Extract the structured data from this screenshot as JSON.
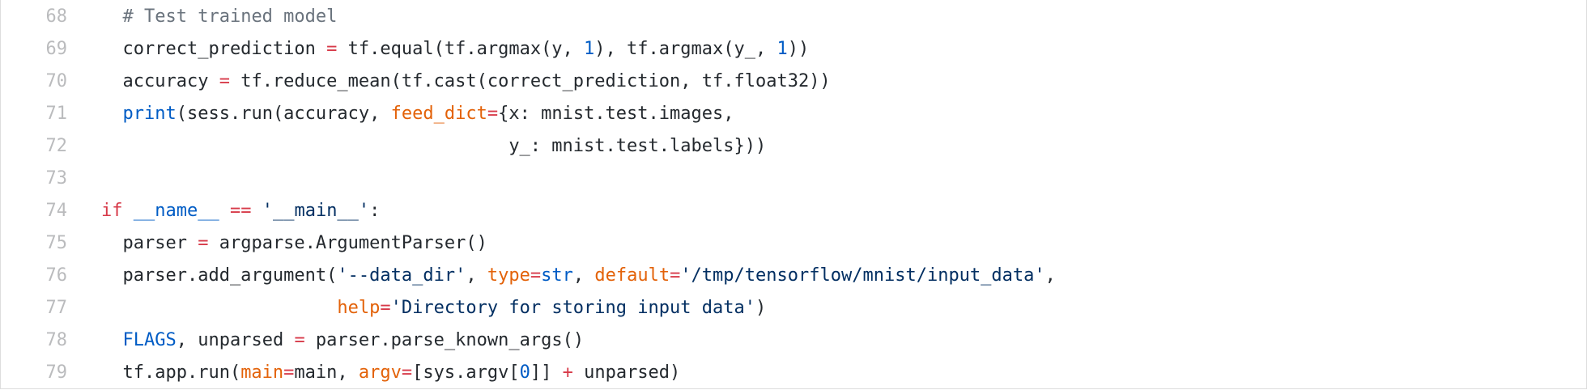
{
  "colors": {
    "line_number": "#b7b8ba",
    "comment": "#6a737d",
    "plain": "#24292e",
    "keyword": "#d73a49",
    "name": "#005cc5",
    "string": "#032f62",
    "param": "#e36209",
    "border": "#dddddd"
  },
  "lines": [
    {
      "number": "68",
      "tokens": [
        {
          "type": "plain",
          "text": "  "
        },
        {
          "type": "comment",
          "text": "# Test trained model"
        }
      ]
    },
    {
      "number": "69",
      "tokens": [
        {
          "type": "plain",
          "text": "  correct_prediction "
        },
        {
          "type": "operator",
          "text": "="
        },
        {
          "type": "plain",
          "text": " tf.equal(tf.argmax(y, "
        },
        {
          "type": "number",
          "text": "1"
        },
        {
          "type": "plain",
          "text": "), tf.argmax(y_, "
        },
        {
          "type": "number",
          "text": "1"
        },
        {
          "type": "plain",
          "text": "))"
        }
      ]
    },
    {
      "number": "70",
      "tokens": [
        {
          "type": "plain",
          "text": "  accuracy "
        },
        {
          "type": "operator",
          "text": "="
        },
        {
          "type": "plain",
          "text": " tf.reduce_mean(tf.cast(correct_prediction, tf.float32))"
        }
      ]
    },
    {
      "number": "71",
      "tokens": [
        {
          "type": "plain",
          "text": "  "
        },
        {
          "type": "name",
          "text": "print"
        },
        {
          "type": "plain",
          "text": "(sess.run(accuracy, "
        },
        {
          "type": "param",
          "text": "feed_dict"
        },
        {
          "type": "operator",
          "text": "="
        },
        {
          "type": "plain",
          "text": "{x: mnist.test.images,"
        }
      ]
    },
    {
      "number": "72",
      "tokens": [
        {
          "type": "plain",
          "text": "                                      y_: mnist.test.labels}))"
        }
      ]
    },
    {
      "number": "73",
      "tokens": []
    },
    {
      "number": "74",
      "tokens": [
        {
          "type": "keyword",
          "text": "if"
        },
        {
          "type": "plain",
          "text": " "
        },
        {
          "type": "name",
          "text": "__name__"
        },
        {
          "type": "plain",
          "text": " "
        },
        {
          "type": "operator",
          "text": "=="
        },
        {
          "type": "plain",
          "text": " "
        },
        {
          "type": "string",
          "text": "'__main__'"
        },
        {
          "type": "plain",
          "text": ":"
        }
      ]
    },
    {
      "number": "75",
      "tokens": [
        {
          "type": "plain",
          "text": "  parser "
        },
        {
          "type": "operator",
          "text": "="
        },
        {
          "type": "plain",
          "text": " argparse.ArgumentParser()"
        }
      ]
    },
    {
      "number": "76",
      "tokens": [
        {
          "type": "plain",
          "text": "  parser.add_argument("
        },
        {
          "type": "string",
          "text": "'--data_dir'"
        },
        {
          "type": "plain",
          "text": ", "
        },
        {
          "type": "param",
          "text": "type"
        },
        {
          "type": "operator",
          "text": "="
        },
        {
          "type": "name",
          "text": "str"
        },
        {
          "type": "plain",
          "text": ", "
        },
        {
          "type": "param",
          "text": "default"
        },
        {
          "type": "operator",
          "text": "="
        },
        {
          "type": "string",
          "text": "'/tmp/tensorflow/mnist/input_data'"
        },
        {
          "type": "plain",
          "text": ","
        }
      ]
    },
    {
      "number": "77",
      "tokens": [
        {
          "type": "plain",
          "text": "                      "
        },
        {
          "type": "param",
          "text": "help"
        },
        {
          "type": "operator",
          "text": "="
        },
        {
          "type": "string",
          "text": "'Directory for storing input data'"
        },
        {
          "type": "plain",
          "text": ")"
        }
      ]
    },
    {
      "number": "78",
      "tokens": [
        {
          "type": "plain",
          "text": "  "
        },
        {
          "type": "name",
          "text": "FLAGS"
        },
        {
          "type": "plain",
          "text": ", unparsed "
        },
        {
          "type": "operator",
          "text": "="
        },
        {
          "type": "plain",
          "text": " parser.parse_known_args()"
        }
      ]
    },
    {
      "number": "79",
      "tokens": [
        {
          "type": "plain",
          "text": "  tf.app.run("
        },
        {
          "type": "param",
          "text": "main"
        },
        {
          "type": "operator",
          "text": "="
        },
        {
          "type": "plain",
          "text": "main, "
        },
        {
          "type": "param",
          "text": "argv"
        },
        {
          "type": "operator",
          "text": "="
        },
        {
          "type": "plain",
          "text": "[sys.argv["
        },
        {
          "type": "number",
          "text": "0"
        },
        {
          "type": "plain",
          "text": "]] "
        },
        {
          "type": "operator",
          "text": "+"
        },
        {
          "type": "plain",
          "text": " unparsed)"
        }
      ]
    }
  ]
}
